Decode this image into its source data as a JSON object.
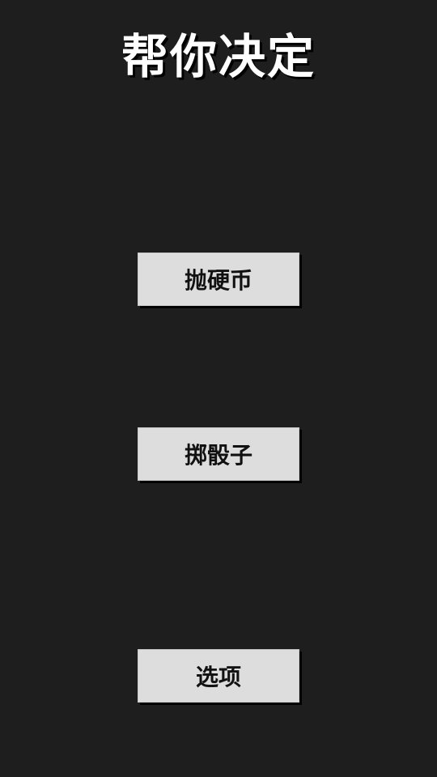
{
  "app": {
    "title": "帮你决定"
  },
  "buttons": {
    "coin": "抛硬币",
    "dice": "掷骰子",
    "options": "选项"
  },
  "colors": {
    "background": "#1e1e1e",
    "button": "#dddddd",
    "title_text": "#ffffff",
    "button_text": "#111111"
  }
}
